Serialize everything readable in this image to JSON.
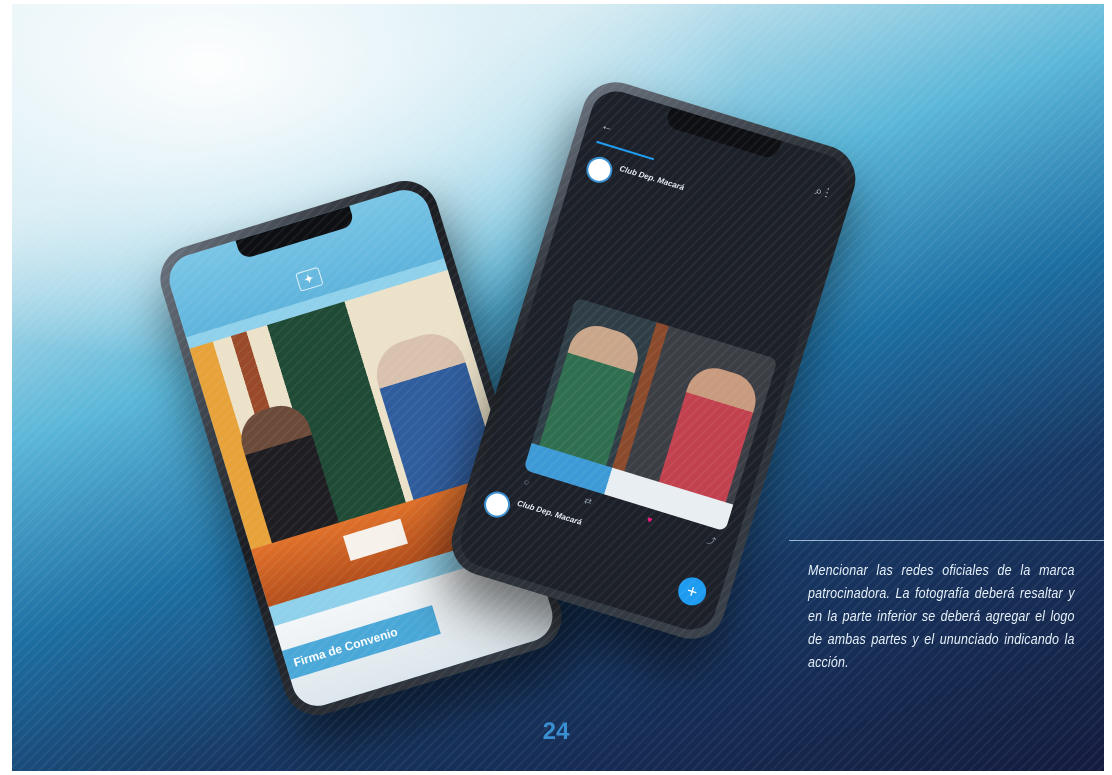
{
  "left_phone": {
    "caption": "Firma de Convenio",
    "placard_text": "",
    "brand_text": ""
  },
  "right_phone": {
    "tweet1": {
      "name": "Club Dep. Macará",
      "handle": "",
      "body": ""
    },
    "tweet2": {
      "name": "Club Dep. Macará",
      "handle": "",
      "body": ""
    },
    "fab_icon": "plus-icon",
    "back_icon": "back-arrow-icon",
    "search_icon": "search-icon",
    "more_icon": "more-vertical-icon"
  },
  "description": "Mencionar las redes oficiales de la marca patrocinadora. La fotografía deberá resaltar y en la parte inferior se deberá agregar el logo de ambas partes y el ununciado indicando la acción.",
  "page_number": "24",
  "colors": {
    "accent": "#3a8fd0",
    "caption_bg": "#4aa8d8",
    "text_light": "#e8f2fa",
    "background_dark": "#141b3e"
  }
}
